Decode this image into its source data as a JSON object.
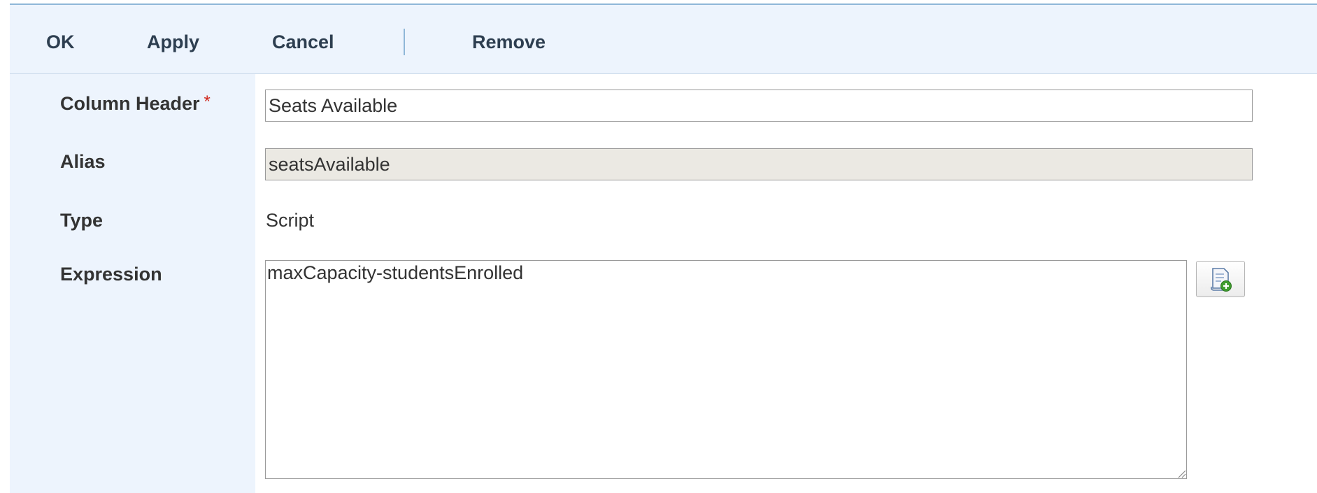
{
  "toolbar": {
    "ok_label": "OK",
    "apply_label": "Apply",
    "cancel_label": "Cancel",
    "remove_label": "Remove"
  },
  "form": {
    "column_header": {
      "label": "Column Header",
      "required_marker": "*",
      "value": "Seats Available"
    },
    "alias": {
      "label": "Alias",
      "value": "seatsAvailable"
    },
    "type": {
      "label": "Type",
      "value": "Script"
    },
    "expression": {
      "label": "Expression",
      "value": "maxCapacity-studentsEnrolled",
      "script_button_icon": "script-add-icon"
    }
  },
  "colors": {
    "toolbar_bg": "#edf4fd",
    "toolbar_text": "#2d3e50",
    "required": "#d0281d",
    "readonly_bg": "#ebe9e3"
  }
}
